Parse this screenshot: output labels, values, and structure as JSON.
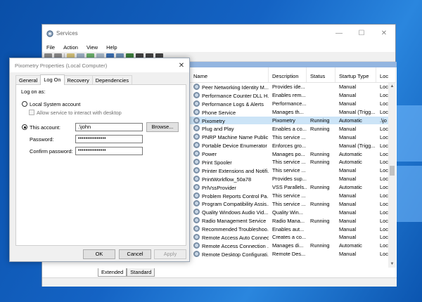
{
  "services_window": {
    "title": "Services",
    "menu": [
      "File",
      "Action",
      "View",
      "Help"
    ],
    "columns": [
      "Name",
      "Description",
      "Status",
      "Startup Type",
      "Loc"
    ],
    "rows": [
      {
        "name": "Peer Networking Identity M...",
        "desc": "Provides ide...",
        "status": "",
        "startup": "Manual",
        "log": "Loc"
      },
      {
        "name": "Performance Counter DLL H...",
        "desc": "Enables rem...",
        "status": "",
        "startup": "Manual",
        "log": "Loc"
      },
      {
        "name": "Performance Logs & Alerts",
        "desc": "Performance...",
        "status": "",
        "startup": "Manual",
        "log": "Loc"
      },
      {
        "name": "Phone Service",
        "desc": "Manages th...",
        "status": "",
        "startup": "Manual (Trigg...",
        "log": "Loc"
      },
      {
        "name": "Pixometry",
        "desc": "Pixometry",
        "status": "Running",
        "startup": "Automatic",
        "log": ".\\jo"
      },
      {
        "name": "Plug and Play",
        "desc": "Enables a co...",
        "status": "Running",
        "startup": "Manual",
        "log": "Loc"
      },
      {
        "name": "PNRP Machine Name Public...",
        "desc": "This service ...",
        "status": "",
        "startup": "Manual",
        "log": "Loc"
      },
      {
        "name": "Portable Device Enumerator ...",
        "desc": "Enforces gro...",
        "status": "",
        "startup": "Manual (Trigg...",
        "log": "Loc"
      },
      {
        "name": "Power",
        "desc": "Manages po...",
        "status": "Running",
        "startup": "Automatic",
        "log": "Loc"
      },
      {
        "name": "Print Spooler",
        "desc": "This service ...",
        "status": "Running",
        "startup": "Automatic",
        "log": "Loc"
      },
      {
        "name": "Printer Extensions and Notifi...",
        "desc": "This service ...",
        "status": "",
        "startup": "Manual",
        "log": "Loc"
      },
      {
        "name": "PrintWorkflow_50a78",
        "desc": "Provides sup...",
        "status": "",
        "startup": "Manual",
        "log": "Loc"
      },
      {
        "name": "PrlVssProvider",
        "desc": "VSS Parallels...",
        "status": "Running",
        "startup": "Automatic",
        "log": "Loc"
      },
      {
        "name": "Problem Reports Control Pa...",
        "desc": "This service ...",
        "status": "",
        "startup": "Manual",
        "log": "Loc"
      },
      {
        "name": "Program Compatibility Assis...",
        "desc": "This service ...",
        "status": "Running",
        "startup": "Manual",
        "log": "Loc"
      },
      {
        "name": "Quality Windows Audio Vid...",
        "desc": "Quality Win...",
        "status": "",
        "startup": "Manual",
        "log": "Loc"
      },
      {
        "name": "Radio Management Service",
        "desc": "Radio Mana...",
        "status": "Running",
        "startup": "Manual",
        "log": "Loc"
      },
      {
        "name": "Recommended Troubleshoo...",
        "desc": "Enables aut...",
        "status": "",
        "startup": "Manual",
        "log": "Loc"
      },
      {
        "name": "Remote Access Auto Connec...",
        "desc": "Creates a co...",
        "status": "",
        "startup": "Manual",
        "log": "Loc"
      },
      {
        "name": "Remote Access Connection ...",
        "desc": "Manages di...",
        "status": "Running",
        "startup": "Automatic",
        "log": "Loc"
      },
      {
        "name": "Remote Desktop Configurati...",
        "desc": "Remote Des...",
        "status": "",
        "startup": "Manual",
        "log": "Loc"
      }
    ],
    "selected_row": 4,
    "bottom_tabs": [
      "Extended",
      "Standard"
    ]
  },
  "dialog": {
    "title": "Pixometry Properties (Local Computer)",
    "tabs": [
      "General",
      "Log On",
      "Recovery",
      "Dependencies"
    ],
    "active_tab": "Log On",
    "log_on_as": "Log on as:",
    "local_system": "Local System account",
    "allow_interact": "Allow service to interact with desktop",
    "this_account": "This account:",
    "account_value": ".\\john",
    "browse": "Browse...",
    "password_label": "Password:",
    "password_value": "•••••••••••••••",
    "confirm_label": "Confirm password:",
    "confirm_value": "•••••••••••••••",
    "ok": "OK",
    "cancel": "Cancel",
    "apply": "Apply"
  }
}
